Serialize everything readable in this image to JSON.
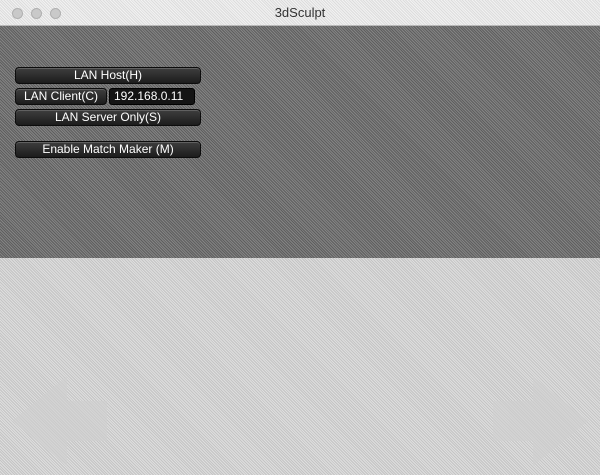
{
  "window": {
    "title": "3dSculpt"
  },
  "network_menu": {
    "lan_host_label": "LAN Host(H)",
    "lan_client_label": "LAN Client(C)",
    "server_address_value": "192.168.0.11",
    "lan_server_only_label": "LAN Server Only(S)",
    "enable_match_maker_label": "Enable Match Maker (M)"
  },
  "controls": {
    "left_arrow_icon": "arrow-left-icon",
    "right_arrow_icon": "arrow-right-icon"
  },
  "colors": {
    "button_background": "#2a2a2a",
    "button_text": "#ffffff",
    "viewport_top": "#6e6e6e",
    "viewport_bottom": "#d2d2d2"
  }
}
